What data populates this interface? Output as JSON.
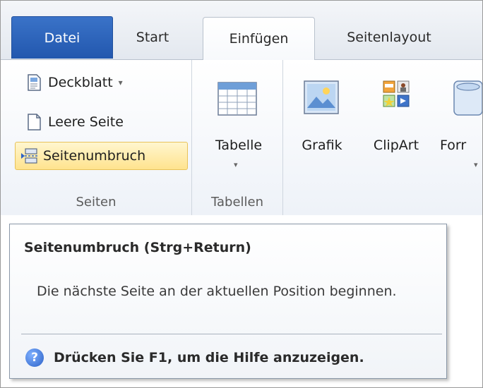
{
  "tabs": {
    "datei": "Datei",
    "start": "Start",
    "einfuegen": "Einfügen",
    "seitenlayout": "Seitenlayout"
  },
  "ribbon": {
    "seiten_group": {
      "label": "Seiten",
      "deckblatt": "Deckblatt",
      "deckblatt_caret": "▾",
      "leere_seite": "Leere Seite",
      "seitenumbruch": "Seitenumbruch"
    },
    "tabellen_group": {
      "label": "Tabellen",
      "tabelle": "Tabelle",
      "tabelle_caret": "▾"
    },
    "illustrationen": {
      "grafik": "Grafik",
      "clipart": "ClipArt",
      "formen": "Forr",
      "formen_caret": "▾"
    }
  },
  "tooltip": {
    "title": "Seitenumbruch (Strg+Return)",
    "description": "Die nächste Seite an der aktuellen Position beginnen.",
    "help_glyph": "?",
    "help_text": "Drücken Sie F1, um die Hilfe anzuzeigen."
  },
  "colors": {
    "datei_tab": "#2a62b8",
    "highlight": "#ffe38e",
    "help_icon": "#2c62c7"
  }
}
